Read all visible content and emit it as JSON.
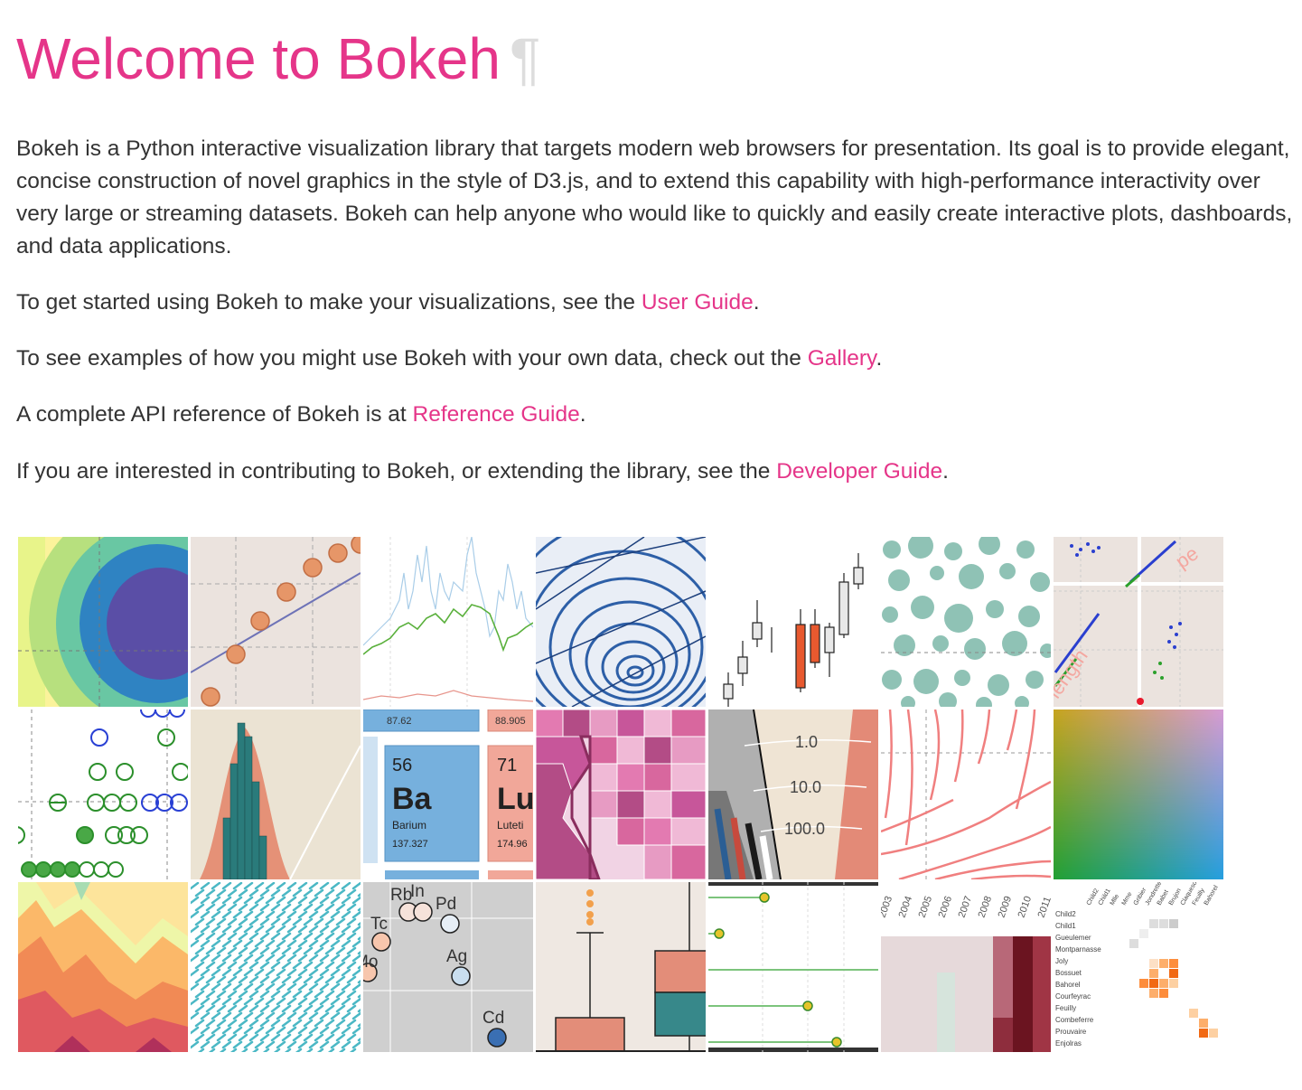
{
  "title": "Welcome to Bokeh",
  "pilcrow": "¶",
  "paragraphs": {
    "intro": "Bokeh is a Python interactive visualization library that targets modern web browsers for presentation. Its goal is to provide elegant, concise construction of novel graphics in the style of D3.js, and to extend this capability with high-performance interactivity over very large or streaming datasets. Bokeh can help anyone who would like to quickly and easily create interactive plots, dashboards, and data applications.",
    "user_guide": {
      "before": "To get started using Bokeh to make your visualizations, see the ",
      "link": "User Guide",
      "after": "."
    },
    "gallery": {
      "before": "To see examples of how you might use Bokeh with your own data, check out the ",
      "link": "Gallery",
      "after": "."
    },
    "reference": {
      "before": "A complete API reference of Bokeh is at ",
      "link": "Reference Guide",
      "after": "."
    },
    "developer": {
      "before": "If you are interested in contributing to Bokeh, or extending the library, see the ",
      "link": "Developer Guide",
      "after": "."
    }
  },
  "colors": {
    "accent": "#e53589",
    "text": "#333333",
    "pilcrow": "#dddddd"
  },
  "gallery_thumbnails": {
    "periodic": {
      "val1": "87.62",
      "val2": "88.905",
      "num1": "56",
      "sym1": "Ba",
      "name1": "Barium",
      "mass1": "137.327",
      "num2": "71",
      "sym2": "Lu",
      "name2": "Luteti",
      "mass2": "174.96"
    },
    "log_axis": {
      "t1": "1.0",
      "t2": "10.0",
      "t3": "100.0"
    },
    "elements": {
      "e1": "Rb",
      "e2": "In",
      "e3": "Pd",
      "e4": "Tc",
      "e5": "Mo",
      "e6": "Ag",
      "e7": "Cd"
    },
    "scatter_splom": {
      "label1": "pe",
      "label2": "length"
    },
    "heatmap_years": [
      "2003",
      "2004",
      "2005",
      "2006",
      "2007",
      "2008",
      "2009",
      "2010",
      "2011"
    ],
    "les_mis_top": [
      "Child2",
      "Child1",
      "Mlle",
      "Mme",
      "Gribier",
      "Jondrette",
      "Babet",
      "Brujon",
      "Claquesous",
      "Feuilly",
      "Bahorel"
    ],
    "les_mis_side": [
      "Child2",
      "Child1",
      "Gueulemer",
      "Montparnasse",
      "Joly",
      "Bossuet",
      "Bahorel",
      "Courfeyrac",
      "Feuilly",
      "Combeferre",
      "Prouvaire",
      "Enjolras"
    ]
  }
}
